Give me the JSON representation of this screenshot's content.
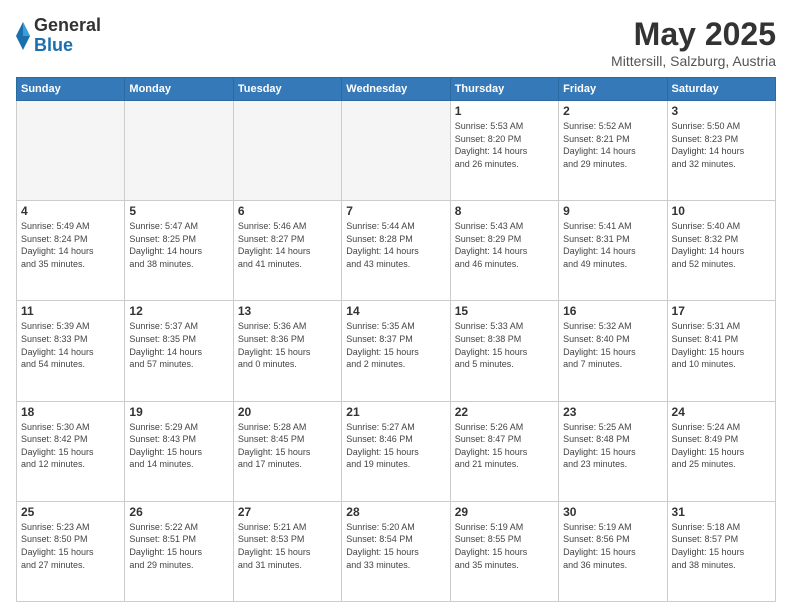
{
  "header": {
    "logo_general": "General",
    "logo_blue": "Blue",
    "month_title": "May 2025",
    "location": "Mittersill, Salzburg, Austria"
  },
  "weekdays": [
    "Sunday",
    "Monday",
    "Tuesday",
    "Wednesday",
    "Thursday",
    "Friday",
    "Saturday"
  ],
  "weeks": [
    [
      {
        "day": "",
        "info": ""
      },
      {
        "day": "",
        "info": ""
      },
      {
        "day": "",
        "info": ""
      },
      {
        "day": "",
        "info": ""
      },
      {
        "day": "1",
        "info": "Sunrise: 5:53 AM\nSunset: 8:20 PM\nDaylight: 14 hours\nand 26 minutes."
      },
      {
        "day": "2",
        "info": "Sunrise: 5:52 AM\nSunset: 8:21 PM\nDaylight: 14 hours\nand 29 minutes."
      },
      {
        "day": "3",
        "info": "Sunrise: 5:50 AM\nSunset: 8:23 PM\nDaylight: 14 hours\nand 32 minutes."
      }
    ],
    [
      {
        "day": "4",
        "info": "Sunrise: 5:49 AM\nSunset: 8:24 PM\nDaylight: 14 hours\nand 35 minutes."
      },
      {
        "day": "5",
        "info": "Sunrise: 5:47 AM\nSunset: 8:25 PM\nDaylight: 14 hours\nand 38 minutes."
      },
      {
        "day": "6",
        "info": "Sunrise: 5:46 AM\nSunset: 8:27 PM\nDaylight: 14 hours\nand 41 minutes."
      },
      {
        "day": "7",
        "info": "Sunrise: 5:44 AM\nSunset: 8:28 PM\nDaylight: 14 hours\nand 43 minutes."
      },
      {
        "day": "8",
        "info": "Sunrise: 5:43 AM\nSunset: 8:29 PM\nDaylight: 14 hours\nand 46 minutes."
      },
      {
        "day": "9",
        "info": "Sunrise: 5:41 AM\nSunset: 8:31 PM\nDaylight: 14 hours\nand 49 minutes."
      },
      {
        "day": "10",
        "info": "Sunrise: 5:40 AM\nSunset: 8:32 PM\nDaylight: 14 hours\nand 52 minutes."
      }
    ],
    [
      {
        "day": "11",
        "info": "Sunrise: 5:39 AM\nSunset: 8:33 PM\nDaylight: 14 hours\nand 54 minutes."
      },
      {
        "day": "12",
        "info": "Sunrise: 5:37 AM\nSunset: 8:35 PM\nDaylight: 14 hours\nand 57 minutes."
      },
      {
        "day": "13",
        "info": "Sunrise: 5:36 AM\nSunset: 8:36 PM\nDaylight: 15 hours\nand 0 minutes."
      },
      {
        "day": "14",
        "info": "Sunrise: 5:35 AM\nSunset: 8:37 PM\nDaylight: 15 hours\nand 2 minutes."
      },
      {
        "day": "15",
        "info": "Sunrise: 5:33 AM\nSunset: 8:38 PM\nDaylight: 15 hours\nand 5 minutes."
      },
      {
        "day": "16",
        "info": "Sunrise: 5:32 AM\nSunset: 8:40 PM\nDaylight: 15 hours\nand 7 minutes."
      },
      {
        "day": "17",
        "info": "Sunrise: 5:31 AM\nSunset: 8:41 PM\nDaylight: 15 hours\nand 10 minutes."
      }
    ],
    [
      {
        "day": "18",
        "info": "Sunrise: 5:30 AM\nSunset: 8:42 PM\nDaylight: 15 hours\nand 12 minutes."
      },
      {
        "day": "19",
        "info": "Sunrise: 5:29 AM\nSunset: 8:43 PM\nDaylight: 15 hours\nand 14 minutes."
      },
      {
        "day": "20",
        "info": "Sunrise: 5:28 AM\nSunset: 8:45 PM\nDaylight: 15 hours\nand 17 minutes."
      },
      {
        "day": "21",
        "info": "Sunrise: 5:27 AM\nSunset: 8:46 PM\nDaylight: 15 hours\nand 19 minutes."
      },
      {
        "day": "22",
        "info": "Sunrise: 5:26 AM\nSunset: 8:47 PM\nDaylight: 15 hours\nand 21 minutes."
      },
      {
        "day": "23",
        "info": "Sunrise: 5:25 AM\nSunset: 8:48 PM\nDaylight: 15 hours\nand 23 minutes."
      },
      {
        "day": "24",
        "info": "Sunrise: 5:24 AM\nSunset: 8:49 PM\nDaylight: 15 hours\nand 25 minutes."
      }
    ],
    [
      {
        "day": "25",
        "info": "Sunrise: 5:23 AM\nSunset: 8:50 PM\nDaylight: 15 hours\nand 27 minutes."
      },
      {
        "day": "26",
        "info": "Sunrise: 5:22 AM\nSunset: 8:51 PM\nDaylight: 15 hours\nand 29 minutes."
      },
      {
        "day": "27",
        "info": "Sunrise: 5:21 AM\nSunset: 8:53 PM\nDaylight: 15 hours\nand 31 minutes."
      },
      {
        "day": "28",
        "info": "Sunrise: 5:20 AM\nSunset: 8:54 PM\nDaylight: 15 hours\nand 33 minutes."
      },
      {
        "day": "29",
        "info": "Sunrise: 5:19 AM\nSunset: 8:55 PM\nDaylight: 15 hours\nand 35 minutes."
      },
      {
        "day": "30",
        "info": "Sunrise: 5:19 AM\nSunset: 8:56 PM\nDaylight: 15 hours\nand 36 minutes."
      },
      {
        "day": "31",
        "info": "Sunrise: 5:18 AM\nSunset: 8:57 PM\nDaylight: 15 hours\nand 38 minutes."
      }
    ]
  ]
}
